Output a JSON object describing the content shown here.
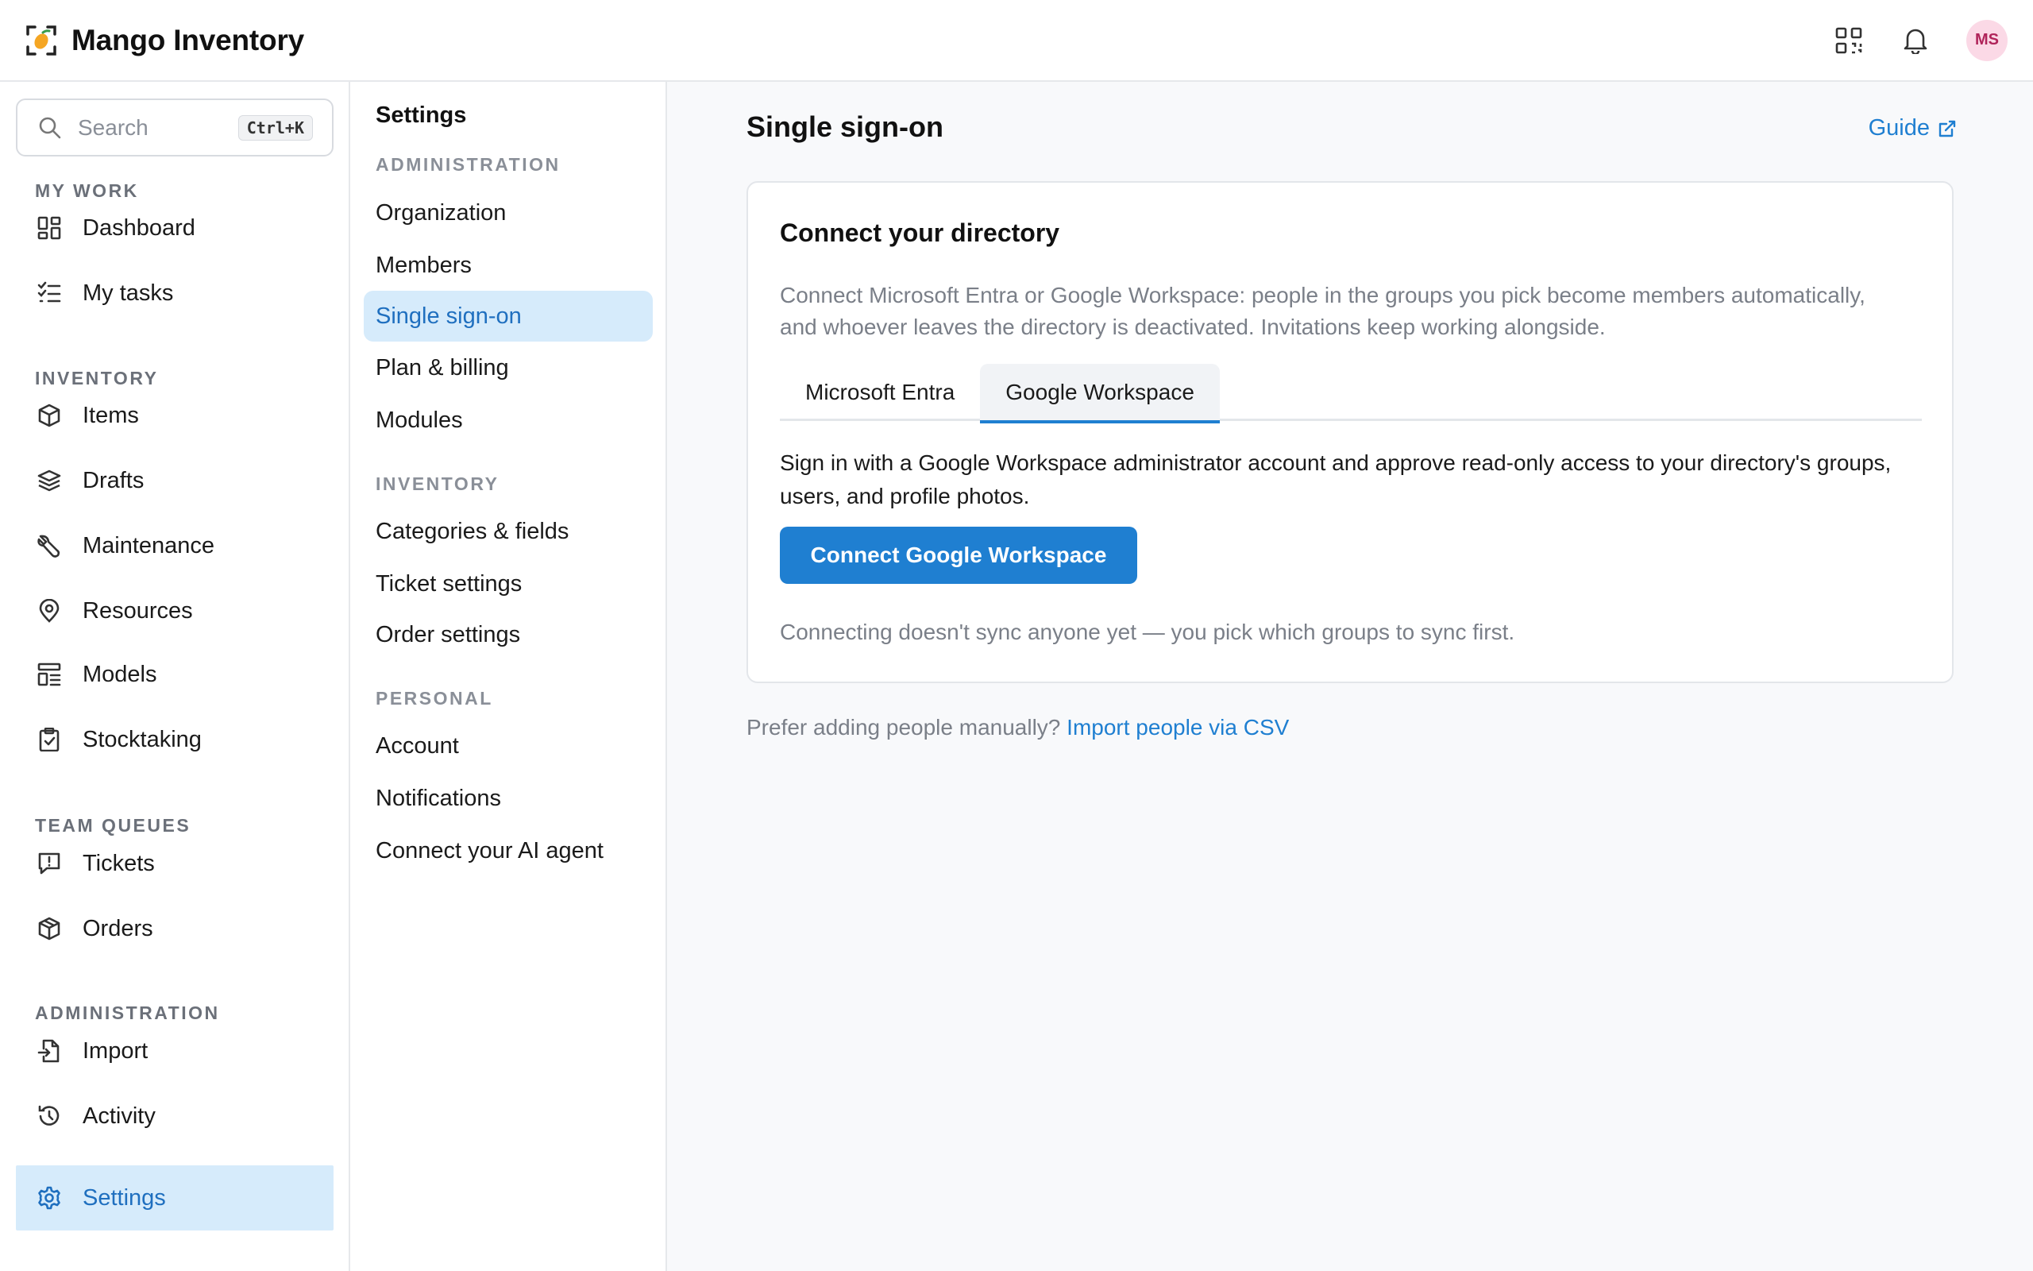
{
  "app": {
    "name": "Mango Inventory",
    "avatar_initials": "MS",
    "accent": "#1f7fd1",
    "brand_color": "#f5a623"
  },
  "header": {
    "icons": [
      "qr-code-icon",
      "bell-icon"
    ]
  },
  "sidebar": {
    "search": {
      "placeholder": "Search",
      "shortcut": "Ctrl+K"
    },
    "sections": {
      "my_work": "MY WORK",
      "inventory": "INVENTORY",
      "team_queues": "TEAM QUEUES",
      "administration": "ADMINISTRATION"
    },
    "items": {
      "dashboard": "Dashboard",
      "my_tasks": "My tasks",
      "items": "Items",
      "drafts": "Drafts",
      "maintenance": "Maintenance",
      "resources": "Resources",
      "models": "Models",
      "stocktaking": "Stocktaking",
      "tickets": "Tickets",
      "orders": "Orders",
      "import": "Import",
      "activity": "Activity",
      "settings": "Settings"
    },
    "active": "settings"
  },
  "subnav": {
    "title": "Settings",
    "sections": {
      "administration": "ADMINISTRATION",
      "inventory": "INVENTORY",
      "personal": "PERSONAL"
    },
    "items": {
      "organization": "Organization",
      "members": "Members",
      "single_sign_on": "Single sign-on",
      "plan_billing": "Plan & billing",
      "modules": "Modules",
      "categories_fields": "Categories & fields",
      "ticket_settings": "Ticket settings",
      "order_settings": "Order settings",
      "account": "Account",
      "notifications": "Notifications",
      "connect_ai_agent": "Connect your AI agent"
    },
    "active": "single_sign_on"
  },
  "main": {
    "title": "Single sign-on",
    "guide_label": "Guide",
    "card": {
      "title": "Connect your directory",
      "description": "Connect Microsoft Entra or Google Workspace: people in the groups you pick become members automatically, and whoever leaves the directory is deactivated. Invitations keep working alongside.",
      "tabs": [
        "Microsoft Entra",
        "Google Workspace"
      ],
      "active_tab": "Google Workspace",
      "body": "Sign in with a Google Workspace administrator account and approve read-only access to your directory's groups, users, and profile photos.",
      "button_label": "Connect Google Workspace",
      "note": "Connecting doesn't sync anyone yet — you pick which groups to sync first."
    },
    "manual_prompt": "Prefer adding people manually?",
    "manual_link": "Import people via CSV"
  }
}
